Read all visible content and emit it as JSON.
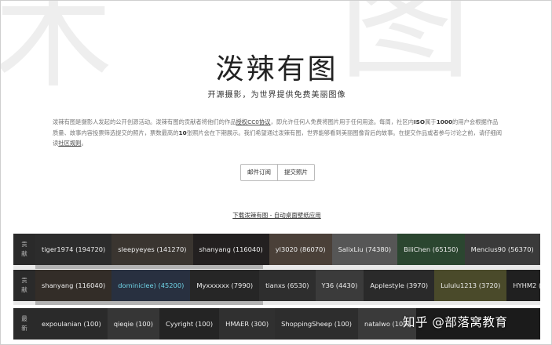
{
  "header": {
    "title": "泼辣有图",
    "subtitle": "开源摄影，为世界提供免费美丽图像"
  },
  "description": {
    "part1": "泼辣有图是摄影人发起的公开创源活动。泼辣有图的贡献者将他们的作品",
    "license_link": "授权CC0协议",
    "part2": "，即允许任何人免费将图片用于任何用途。每周，社区内",
    "iso_text": "ISO",
    "part3": "属于",
    "num_text": "1000",
    "part4": "的用户会根据作品质量、故事内容投票筛选提交的照片，票数最高的",
    "ten_text": "10",
    "part5": "张照片会在下期展示。我们希望通过泼辣有图，世界能够看到美丽图像背后的故事。在提交作品或者参与讨论之前，请仔细阅读",
    "rules_link": "社区规则",
    "part6": "。"
  },
  "buttons": {
    "subscribe": "邮件订阅",
    "submit": "提交照片"
  },
  "download_link": "下载泼辣有图 - 自动桌面壁纸应用",
  "strips": [
    {
      "label_top": "贡",
      "label_bottom": "献",
      "items": [
        {
          "name": "tiger1974 (194720)",
          "bg": "#2c2c2c",
          "hl": false
        },
        {
          "name": "sleepyeyes (141270)",
          "bg": "#3a3530",
          "hl": false
        },
        {
          "name": "shanyang (116040)",
          "bg": "#232020",
          "hl": false
        },
        {
          "name": "yl3020 (86070)",
          "bg": "#4a4038",
          "hl": false
        },
        {
          "name": "SalixLiu (74380)",
          "bg": "#565656",
          "hl": false
        },
        {
          "name": "BiliChen (65150)",
          "bg": "#2b4630",
          "hl": false
        },
        {
          "name": "Mencius90 (56370)",
          "bg": "#3a3a3a",
          "hl": false
        }
      ]
    },
    {
      "label_top": "贡",
      "label_bottom": "献",
      "items": [
        {
          "name": "shanyang (116040)",
          "bg": "#332d28",
          "hl": false
        },
        {
          "name": "dominiclee) (45200)",
          "bg": "#283040",
          "hl": true
        },
        {
          "name": "Myxxxxxx (7990)",
          "bg": "#262626",
          "hl": false
        },
        {
          "name": "tianxs (6530)",
          "bg": "#2e2e2e",
          "hl": false
        },
        {
          "name": "Y36 (4430)",
          "bg": "#3b3b3b",
          "hl": false
        },
        {
          "name": "Applestyle (3970)",
          "bg": "#2a2a2a",
          "hl": false
        },
        {
          "name": "Lululu1213 (3720)",
          "bg": "#4a4a2a",
          "hl": false
        },
        {
          "name": "HYHM2 (",
          "bg": "#202020",
          "hl": false
        }
      ]
    },
    {
      "label_top": "最",
      "label_bottom": "新",
      "items": [
        {
          "name": "expoulanian (100)",
          "bg": "#2a2a2a",
          "hl": false
        },
        {
          "name": "qieqie (100)",
          "bg": "#363636",
          "hl": false
        },
        {
          "name": "Cyyright (100)",
          "bg": "#242424",
          "hl": false
        },
        {
          "name": "HMAER (300)",
          "bg": "#303030",
          "hl": false
        },
        {
          "name": "ShoppingSheep (100)",
          "bg": "#2d2d2d",
          "hl": false
        },
        {
          "name": "natalwo (100)",
          "bg": "#3a3a3a",
          "hl": false
        }
      ]
    }
  ],
  "watermark": "知乎 @部落窝教育",
  "background_glyphs": {
    "left": "木",
    "right": "图"
  }
}
